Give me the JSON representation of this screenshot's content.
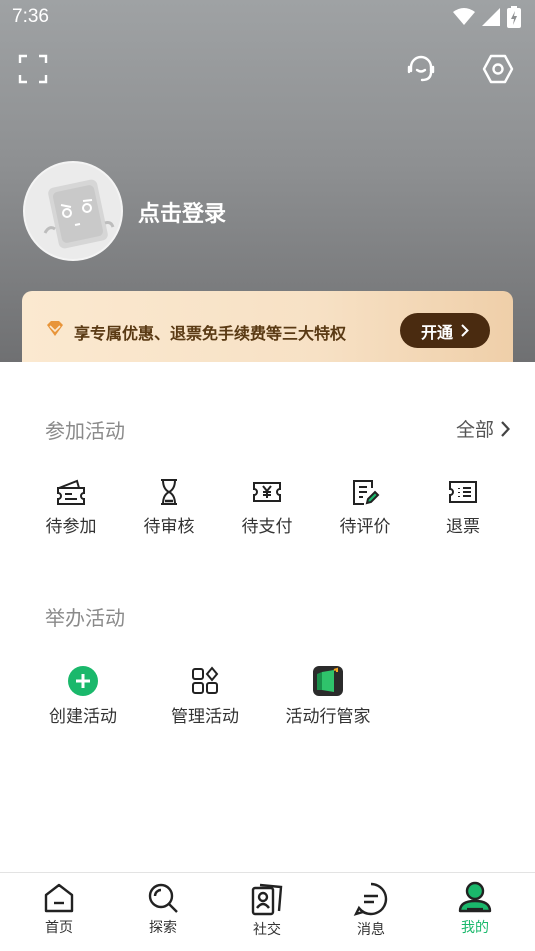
{
  "status_bar": {
    "time": "7:36"
  },
  "profile": {
    "login_prompt": "点击登录"
  },
  "vip": {
    "text": "享专属优惠、退票免手续费等三大特权",
    "button_label": "开通"
  },
  "join_section": {
    "title": "参加活动",
    "see_all_label": "全部",
    "items": [
      {
        "label": "待参加",
        "icon": "ticket-icon"
      },
      {
        "label": "待审核",
        "icon": "hourglass-icon"
      },
      {
        "label": "待支付",
        "icon": "yen-ticket-icon"
      },
      {
        "label": "待评价",
        "icon": "edit-note-icon"
      },
      {
        "label": "退票",
        "icon": "refund-list-icon"
      }
    ]
  },
  "host_section": {
    "title": "举办活动",
    "items": [
      {
        "label": "创建活动",
        "icon": "plus-circle-icon"
      },
      {
        "label": "管理活动",
        "icon": "grid-manage-icon"
      },
      {
        "label": "活动行管家",
        "icon": "app-logo-icon"
      }
    ]
  },
  "tabbar": {
    "tabs": [
      {
        "label": "首页",
        "icon": "home-icon"
      },
      {
        "label": "探索",
        "icon": "search-icon"
      },
      {
        "label": "社交",
        "icon": "social-icon"
      },
      {
        "label": "消息",
        "icon": "message-icon"
      },
      {
        "label": "我的",
        "icon": "profile-icon",
        "active": true
      }
    ]
  },
  "colors": {
    "accent": "#1ab86b",
    "vip_button": "#4a2b10",
    "vip_text": "#5a3a14"
  }
}
